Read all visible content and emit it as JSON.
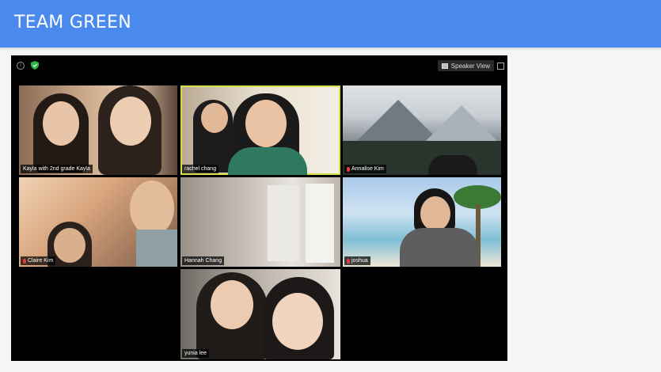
{
  "header": {
    "title": "TEAM GREEN"
  },
  "zoom": {
    "view_button_label": "Speaker View",
    "icons": [
      "info-icon",
      "shield-icon",
      "grid-icon",
      "fullscreen-icon"
    ],
    "participants": [
      {
        "name": "Kayla with 2nd grade Kayla",
        "muted": false
      },
      {
        "name": "rachel chang",
        "muted": false,
        "active_speaker": true
      },
      {
        "name": "Annalise Kim",
        "muted": true
      },
      {
        "name": "Claire Kim",
        "muted": true
      },
      {
        "name": "Hannah Chang",
        "muted": false
      },
      {
        "name": "joshua",
        "muted": true
      },
      {
        "name": "yunia lee",
        "muted": false
      }
    ]
  },
  "colors": {
    "header": "#4a89ee",
    "active_speaker_border": "#d6e04a",
    "muted_icon": "#e23c3c"
  }
}
